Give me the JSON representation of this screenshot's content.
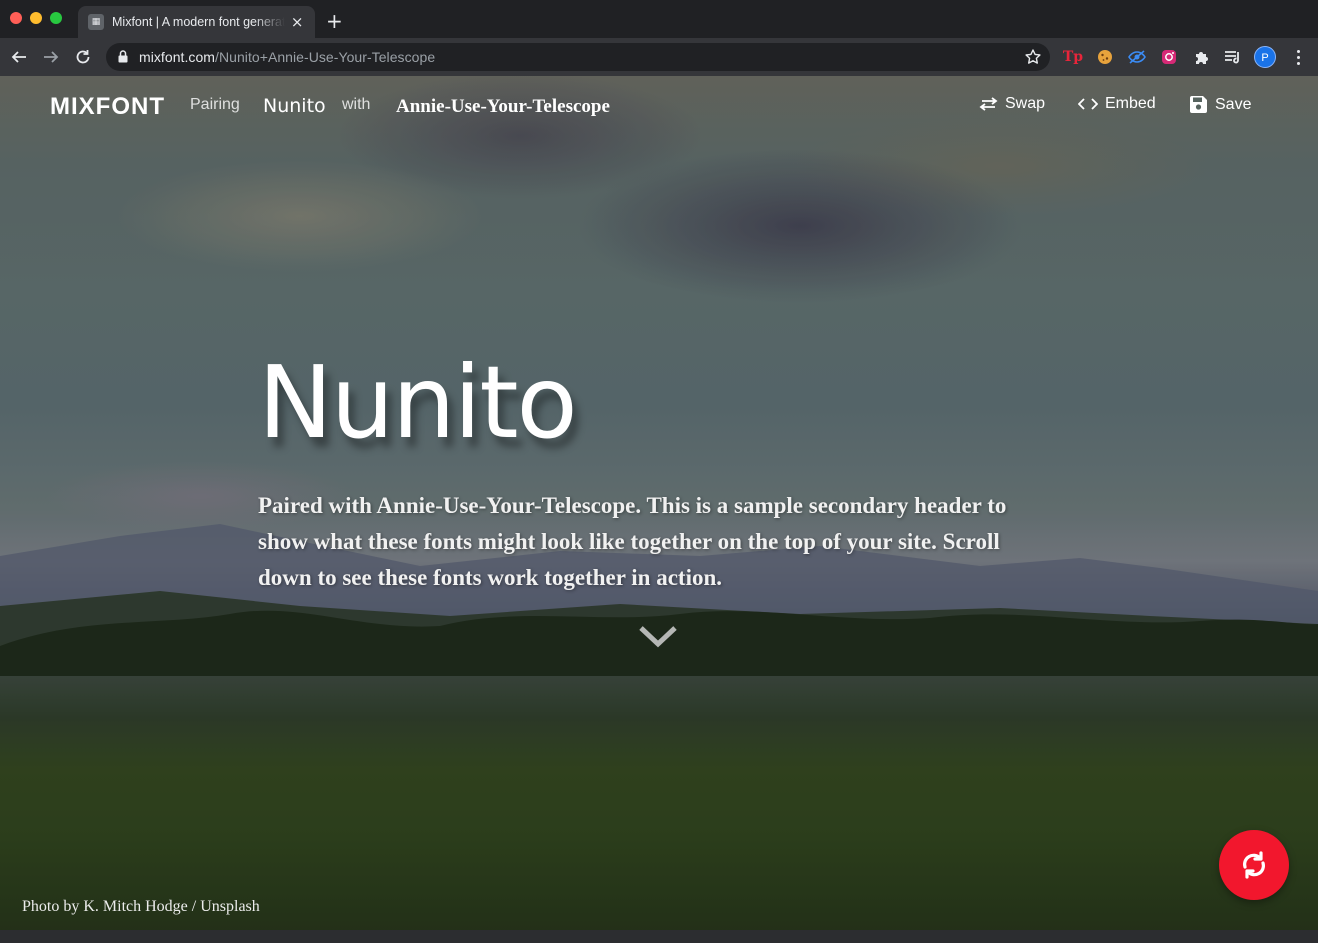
{
  "browser": {
    "tab": {
      "favicon": "mixfont-favicon",
      "title": "Mixfont | A modern font generator",
      "close": "×"
    },
    "new_tab": "+",
    "url_host": "mixfont.com",
    "url_path": "/Nunito+Annie-Use-Your-Telescope",
    "profile_initial": "P",
    "extensions": [
      "tp-extension-icon",
      "cookie-extension-icon",
      "eye-extension-icon",
      "camera-extension-icon",
      "puzzle-icon",
      "media-queue-icon"
    ]
  },
  "nav": {
    "logo": "MIXFONT",
    "pairing_label": "Pairing",
    "font_primary": "Nunito",
    "with_label": "with",
    "font_secondary": "Annie-Use-Your-Telescope",
    "swap_label": "Swap",
    "embed_label": "Embed",
    "save_label": "Save"
  },
  "hero": {
    "title": "Nunito",
    "subtitle": "Paired with Annie-Use-Your-Telescope. This is a sample secondary header to show what these fonts might look like together on the top of your site. Scroll down to see these fonts work together in action."
  },
  "credit": "Photo by K. Mitch Hodge / Unsplash",
  "colors": {
    "accent": "#f2172d",
    "chrome_dark": "#202124",
    "chrome_toolbar": "#35363a"
  }
}
